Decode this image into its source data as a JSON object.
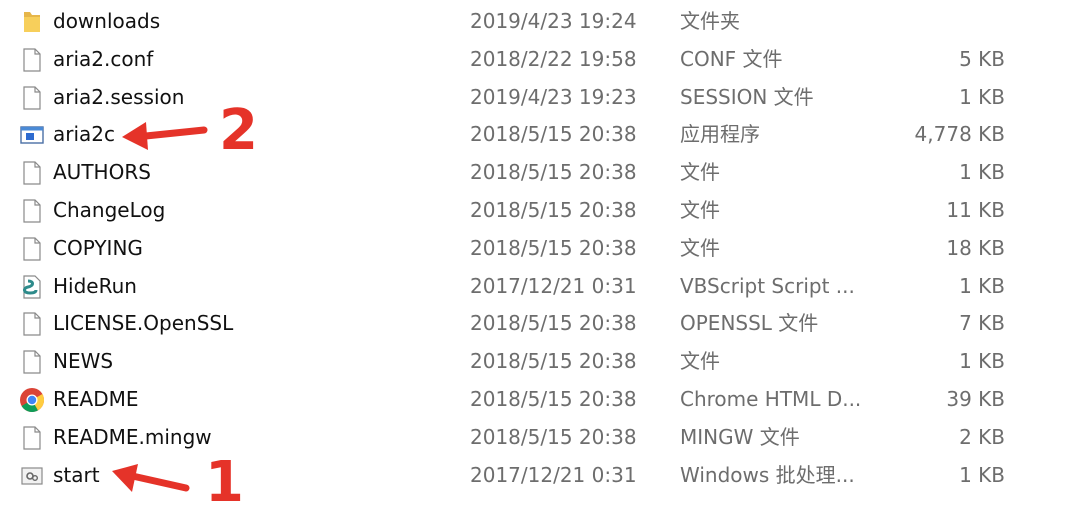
{
  "files": [
    {
      "name": "downloads",
      "date": "2019/4/23 19:24",
      "type": "文件夹",
      "size": "",
      "icon": "folder-icon"
    },
    {
      "name": "aria2.conf",
      "date": "2018/2/22 19:58",
      "type": "CONF 文件",
      "size": "5 KB",
      "icon": "file-icon"
    },
    {
      "name": "aria2.session",
      "date": "2019/4/23 19:23",
      "type": "SESSION 文件",
      "size": "1 KB",
      "icon": "file-icon"
    },
    {
      "name": "aria2c",
      "date": "2018/5/15 20:38",
      "type": "应用程序",
      "size": "4,778 KB",
      "icon": "application-icon"
    },
    {
      "name": "AUTHORS",
      "date": "2018/5/15 20:38",
      "type": "文件",
      "size": "1 KB",
      "icon": "file-icon"
    },
    {
      "name": "ChangeLog",
      "date": "2018/5/15 20:38",
      "type": "文件",
      "size": "11 KB",
      "icon": "file-icon"
    },
    {
      "name": "COPYING",
      "date": "2018/5/15 20:38",
      "type": "文件",
      "size": "18 KB",
      "icon": "file-icon"
    },
    {
      "name": "HideRun",
      "date": "2017/12/21 0:31",
      "type": "VBScript Script ...",
      "size": "1 KB",
      "icon": "vbscript-icon"
    },
    {
      "name": "LICENSE.OpenSSL",
      "date": "2018/5/15 20:38",
      "type": "OPENSSL 文件",
      "size": "7 KB",
      "icon": "file-icon"
    },
    {
      "name": "NEWS",
      "date": "2018/5/15 20:38",
      "type": "文件",
      "size": "1 KB",
      "icon": "file-icon"
    },
    {
      "name": "README",
      "date": "2018/5/15 20:38",
      "type": "Chrome HTML D...",
      "size": "39 KB",
      "icon": "chrome-icon"
    },
    {
      "name": "README.mingw",
      "date": "2018/5/15 20:38",
      "type": "MINGW 文件",
      "size": "2 KB",
      "icon": "file-icon"
    },
    {
      "name": "start",
      "date": "2017/12/21 0:31",
      "type": "Windows 批处理...",
      "size": "1 KB",
      "icon": "batch-file-icon"
    }
  ],
  "annotations": {
    "arrow_1_label": "1",
    "arrow_2_label": "2",
    "color": "#e53329"
  }
}
